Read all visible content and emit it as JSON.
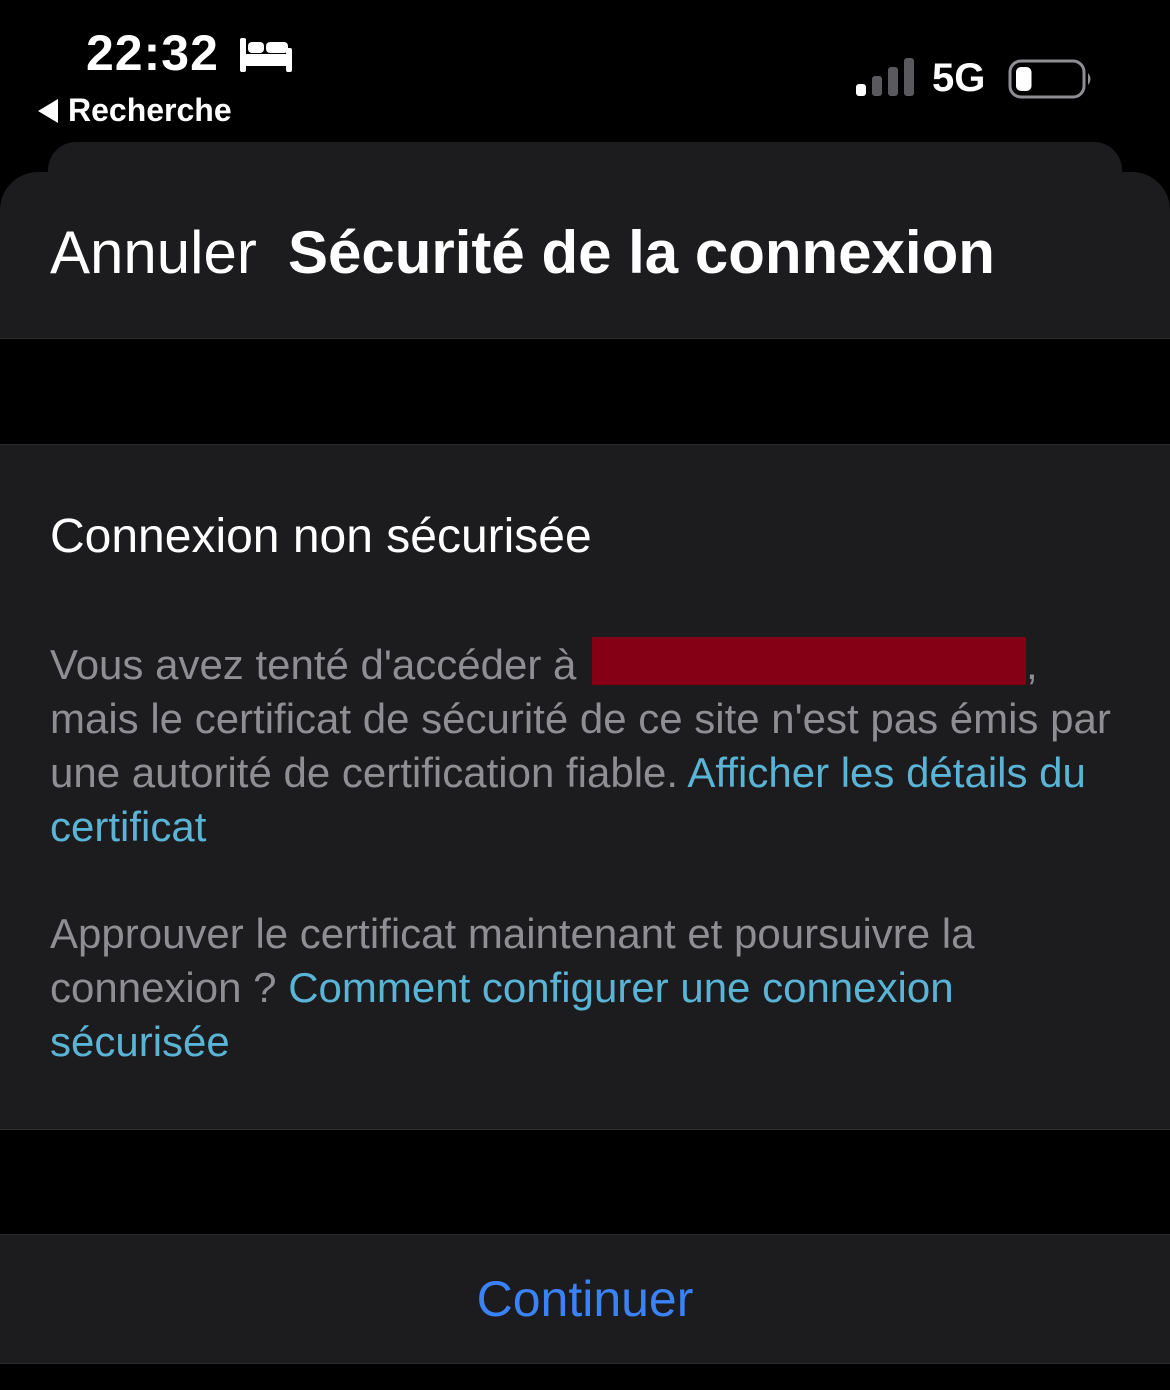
{
  "status_bar": {
    "time": "22:32",
    "back_label": "Recherche",
    "network": "5G",
    "signal_bars_active": 1,
    "signal_bars_total": 4,
    "battery_level": 0.25,
    "icons": [
      "bed-icon",
      "back-triangle-icon",
      "signal-icon",
      "battery-icon"
    ]
  },
  "nav": {
    "cancel_label": "Annuler",
    "title": "Sécurité de la connexion"
  },
  "content": {
    "heading": "Connexion non sécurisée",
    "para1_prefix": "Vous avez tenté d'accéder à",
    "para1_after_redaction": ",",
    "para1_body": "mais le certificat de sécurité de ce site n'est pas émis par une autorité de certification fiable.",
    "para1_link": "Afficher les détails du certificat",
    "para2_body": "Approuver le certificat maintenant et poursuivre la connexion ?",
    "para2_link": "Comment configurer une connexion sécurisée"
  },
  "actions": {
    "continue_label": "Continuer"
  },
  "colors": {
    "background": "#000000",
    "panel": "#1c1c1e",
    "secondary_text": "#8e8e93",
    "link": "#5ab4d6",
    "continue": "#3a82f7",
    "redaction": "#850014"
  }
}
